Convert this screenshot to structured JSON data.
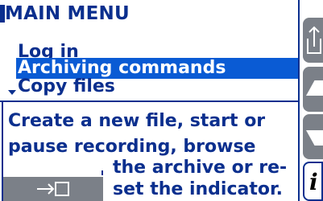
{
  "menu": {
    "title": "MAIN MENU",
    "items": [
      {
        "label": "Log in",
        "selected": false
      },
      {
        "label": "Archiving commands",
        "selected": true
      },
      {
        "label": "Copy files",
        "selected": false
      }
    ]
  },
  "description": {
    "lines": [
      "Create a new file, start or",
      "pause recording, browse",
      "the archive or re-",
      "set the indicator."
    ]
  },
  "buttons": {
    "enter_icon": "enter-icon",
    "side": [
      "export-icon",
      "arrow-up-icon",
      "arrow-down-icon",
      "info-icon"
    ],
    "info_glyph": "i"
  },
  "colors": {
    "text": "#0b2f8e",
    "selection": "#0a5bd4",
    "button": "#7b8088"
  }
}
